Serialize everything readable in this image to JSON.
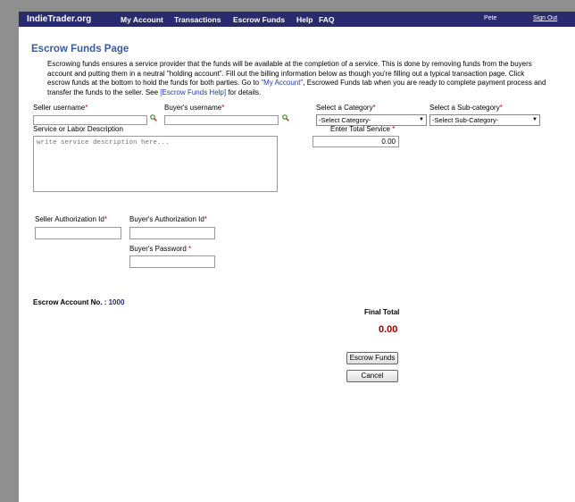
{
  "nav": {
    "brand": "IndieTrader.org",
    "menu": [
      "My Account",
      "Transactions",
      "Escrow Funds",
      "Help",
      "FAQ"
    ],
    "user": "Pete",
    "signout": "Sign Out"
  },
  "page": {
    "title": "Escrow Funds Page",
    "intro_part1": "Escrowing funds ensures a service provider that the funds will be available at the completion of a service.  This is done by removing funds from the buyers account and putting them in a neutral \"holding account\".  Fill out the billing information below as though you're filling out a typical transaction page.  Click escrow funds at the bottom to hold the funds for both parties. Go to ",
    "intro_link1": "\"My Account\"",
    "intro_part2": ", Escrowed Funds tab when you are ready to complete payment process and transfer the funds to the seller.  See ",
    "intro_link2": "[Escrow Funds Help]",
    "intro_part3": " for details."
  },
  "form": {
    "seller_username_label": "Seller username",
    "buyer_username_label": "Buyer's username",
    "category_label": "Select a Category",
    "category_value": "-Select Category-",
    "subcategory_label": "Select a Sub-category",
    "subcategory_value": "-Select Sub-Category-",
    "service_desc_label": "Service or Labor Description",
    "service_desc_placeholder": "write service description here...",
    "total_label": "Enter Total Service ",
    "total_value": "0.00",
    "seller_auth_label": "Seller Authorization Id",
    "buyer_auth_label": "Buyer's Authorization Id",
    "buyer_password_label": "Buyer's Password ",
    "required_mark": "*"
  },
  "account": {
    "label": "Escrow Account No. : ",
    "number": "1000"
  },
  "totals": {
    "final_label": "Final Total",
    "final_value": "0.00"
  },
  "buttons": {
    "escrow": "Escrow Funds",
    "cancel": "Cancel"
  }
}
